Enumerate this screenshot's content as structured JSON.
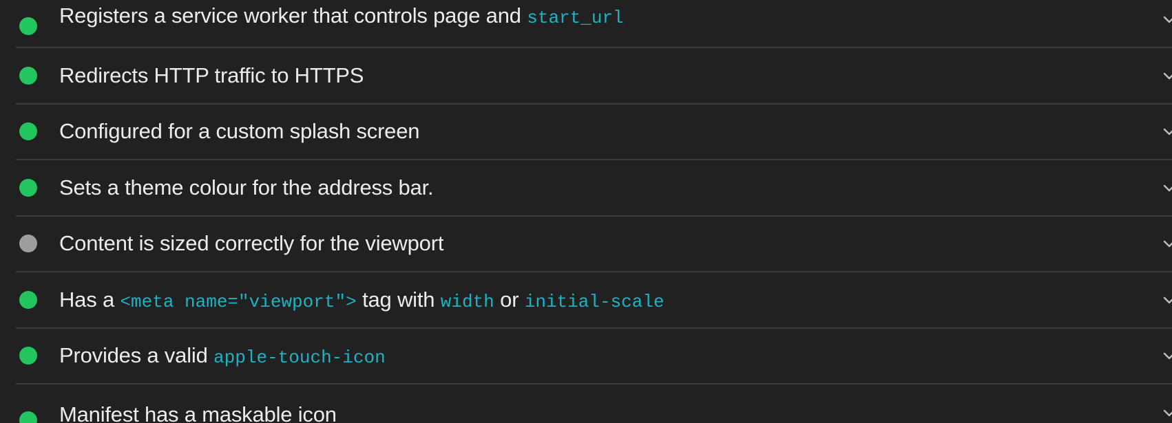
{
  "colors": {
    "pass": "#22c55e",
    "na": "#9e9e9e",
    "code": "#1eb3c4"
  },
  "audits": [
    {
      "status": "pass",
      "parts": [
        {
          "t": "Registers a service worker that controls page and "
        },
        {
          "c": "start_url"
        }
      ]
    },
    {
      "status": "pass",
      "parts": [
        {
          "t": "Redirects HTTP traffic to HTTPS"
        }
      ]
    },
    {
      "status": "pass",
      "parts": [
        {
          "t": "Configured for a custom splash screen"
        }
      ]
    },
    {
      "status": "pass",
      "parts": [
        {
          "t": "Sets a theme colour for the address bar."
        }
      ]
    },
    {
      "status": "na",
      "parts": [
        {
          "t": "Content is sized correctly for the viewport"
        }
      ]
    },
    {
      "status": "pass",
      "parts": [
        {
          "t": "Has a "
        },
        {
          "c": "<meta name=\"viewport\">"
        },
        {
          "t": " tag with "
        },
        {
          "c": "width"
        },
        {
          "t": " or "
        },
        {
          "c": "initial-scale"
        }
      ]
    },
    {
      "status": "pass",
      "parts": [
        {
          "t": "Provides a valid "
        },
        {
          "c": "apple-touch-icon"
        }
      ]
    },
    {
      "status": "pass",
      "parts": [
        {
          "t": "Manifest has a maskable icon"
        }
      ]
    }
  ]
}
